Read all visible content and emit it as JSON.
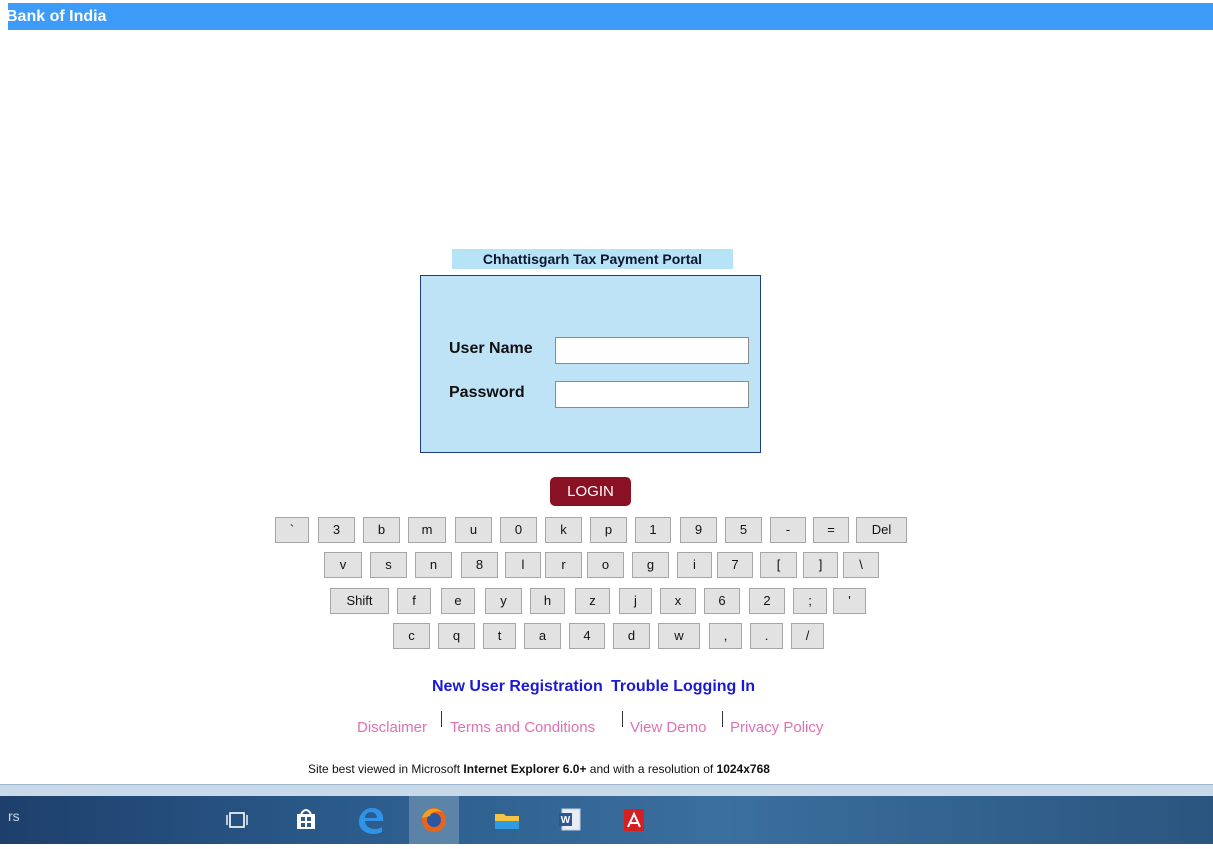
{
  "header": {
    "title": "Bank of India",
    "bg_color": "#3d9bf9"
  },
  "portal": {
    "title": "Chhattisgarh Tax Payment Portal"
  },
  "login": {
    "username_label": "User Name",
    "password_label": "Password",
    "username_value": "",
    "password_value": "",
    "button_label": "LOGIN",
    "button_color": "#8a1024"
  },
  "keyboard": {
    "rows": [
      [
        "`",
        "3",
        "b",
        "m",
        "u",
        "0",
        "k",
        "p",
        "1",
        "9",
        "5",
        "-",
        "=",
        "Del"
      ],
      [
        "v",
        "s",
        "n",
        "8",
        "l",
        "r",
        "o",
        "g",
        "i",
        "7",
        "[",
        "]",
        "\\"
      ],
      [
        "Shift",
        "f",
        "e",
        "y",
        "h",
        "z",
        "j",
        "x",
        "6",
        "2",
        ";",
        "'"
      ],
      [
        "c",
        "q",
        "t",
        "a",
        "4",
        "d",
        "w",
        ",",
        ".",
        "/"
      ]
    ]
  },
  "links": {
    "new_user": "New User Registration",
    "trouble": "Trouble Logging In",
    "disclaimer": "Disclaimer",
    "terms": "Terms and Conditions",
    "demo": "View Demo",
    "privacy": "Privacy Policy"
  },
  "footer": {
    "prefix": "Site best viewed in Microsoft ",
    "browser": "Internet Explorer 6.0+",
    "middle": " and with a resolution of ",
    "resolution": "1024x768"
  },
  "taskbar": {
    "search_hint": "rs",
    "items": [
      "task-view-icon",
      "store-icon",
      "edge-icon",
      "firefox-icon",
      "file-explorer-icon",
      "word-icon",
      "acrobat-icon"
    ]
  }
}
